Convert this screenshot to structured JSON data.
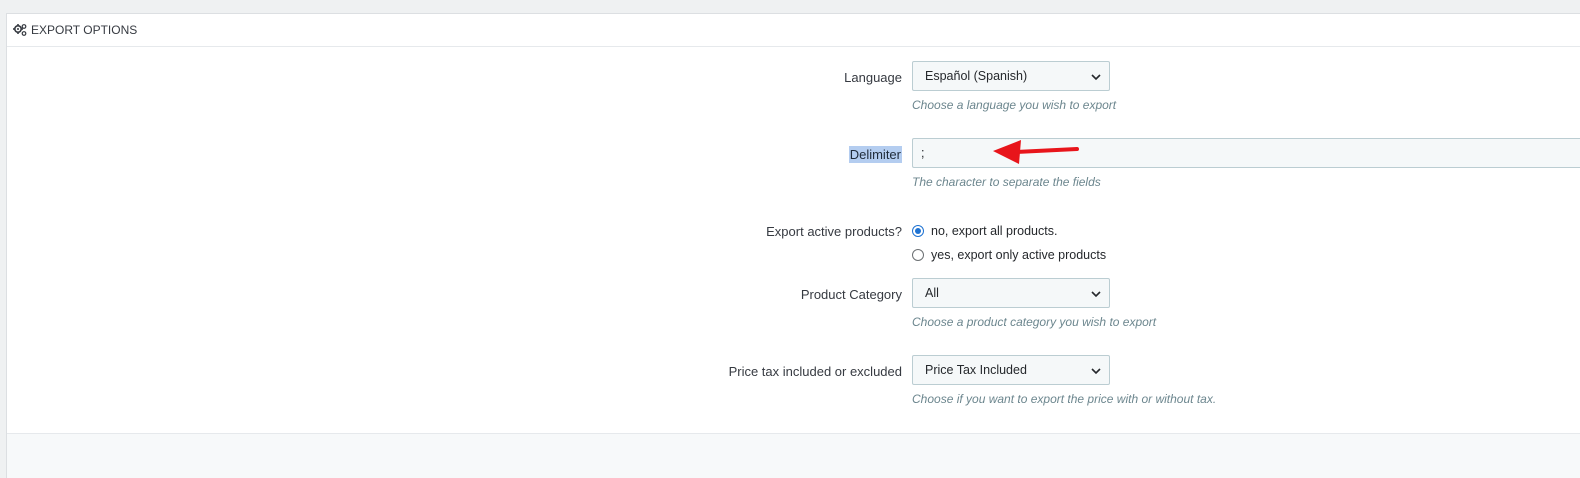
{
  "panel": {
    "heading_icon": "gears-icon",
    "heading": "EXPORT OPTIONS"
  },
  "language": {
    "label": "Language",
    "value": "Español (Spanish)",
    "help": "Choose a language you wish to export"
  },
  "delimiter": {
    "label": "Delimiter",
    "value": ";",
    "help": "The character to separate the fields"
  },
  "active_products": {
    "label": "Export active products?",
    "options": [
      {
        "label": "no, export all products.",
        "checked": true
      },
      {
        "label": "yes, export only active products",
        "checked": false
      }
    ]
  },
  "category": {
    "label": "Product Category",
    "value": "All",
    "help": "Choose a product category you wish to export"
  },
  "price_tax": {
    "label": "Price tax included or excluded",
    "value": "Price Tax Included",
    "help": "Choose if you want to export the price with or without tax."
  },
  "colors": {
    "accent": "#1e72d2",
    "annotation_arrow": "#e8151b",
    "selection_highlight": "#b4cdf0"
  }
}
